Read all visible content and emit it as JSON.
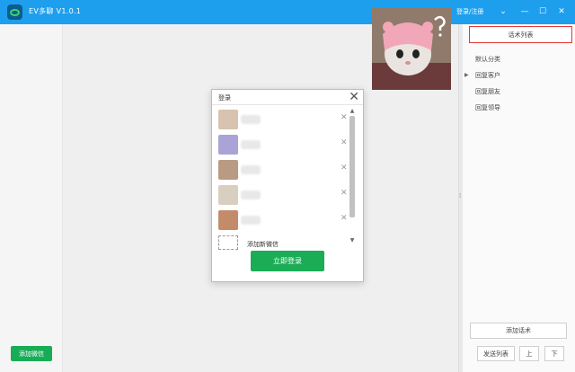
{
  "app": {
    "title": "EV多聊  V1.0.1",
    "login_link": "登录/注册"
  },
  "window_controls": {
    "dropdown": "⌄",
    "minimize": "—",
    "maximize": "☐",
    "close": "✕"
  },
  "left_rail": {
    "add_wechat": "添加微信"
  },
  "right_panel": {
    "header": "话术列表",
    "categories": [
      {
        "label": "默认分类",
        "caret": ""
      },
      {
        "label": "回复客户",
        "caret": "▶"
      },
      {
        "label": "回复朋友",
        "caret": ""
      },
      {
        "label": "回复领导",
        "caret": ""
      }
    ],
    "add_script": "添加话术",
    "bottom_buttons": {
      "send_list": "发送列表",
      "up": "上",
      "down": "下"
    }
  },
  "dialog": {
    "title": "登录",
    "close": "✕",
    "accounts": [
      {
        "remove": "✕",
        "avatar_color": "#d7c3b0"
      },
      {
        "remove": "✕",
        "avatar_color": "#a9a3d6"
      },
      {
        "remove": "✕",
        "avatar_color": "#b99a82"
      },
      {
        "remove": "✕",
        "avatar_color": "#d8cfc0"
      },
      {
        "remove": "✕",
        "avatar_color": "#c48b6b"
      }
    ],
    "add_new": "添加新微信",
    "scroll_up": "▲",
    "scroll_down": "▼",
    "login_now": "立即登录"
  },
  "colors": {
    "titlebar": "#1e9fee",
    "green_button": "#1aad55",
    "header_border": "#e53935"
  }
}
